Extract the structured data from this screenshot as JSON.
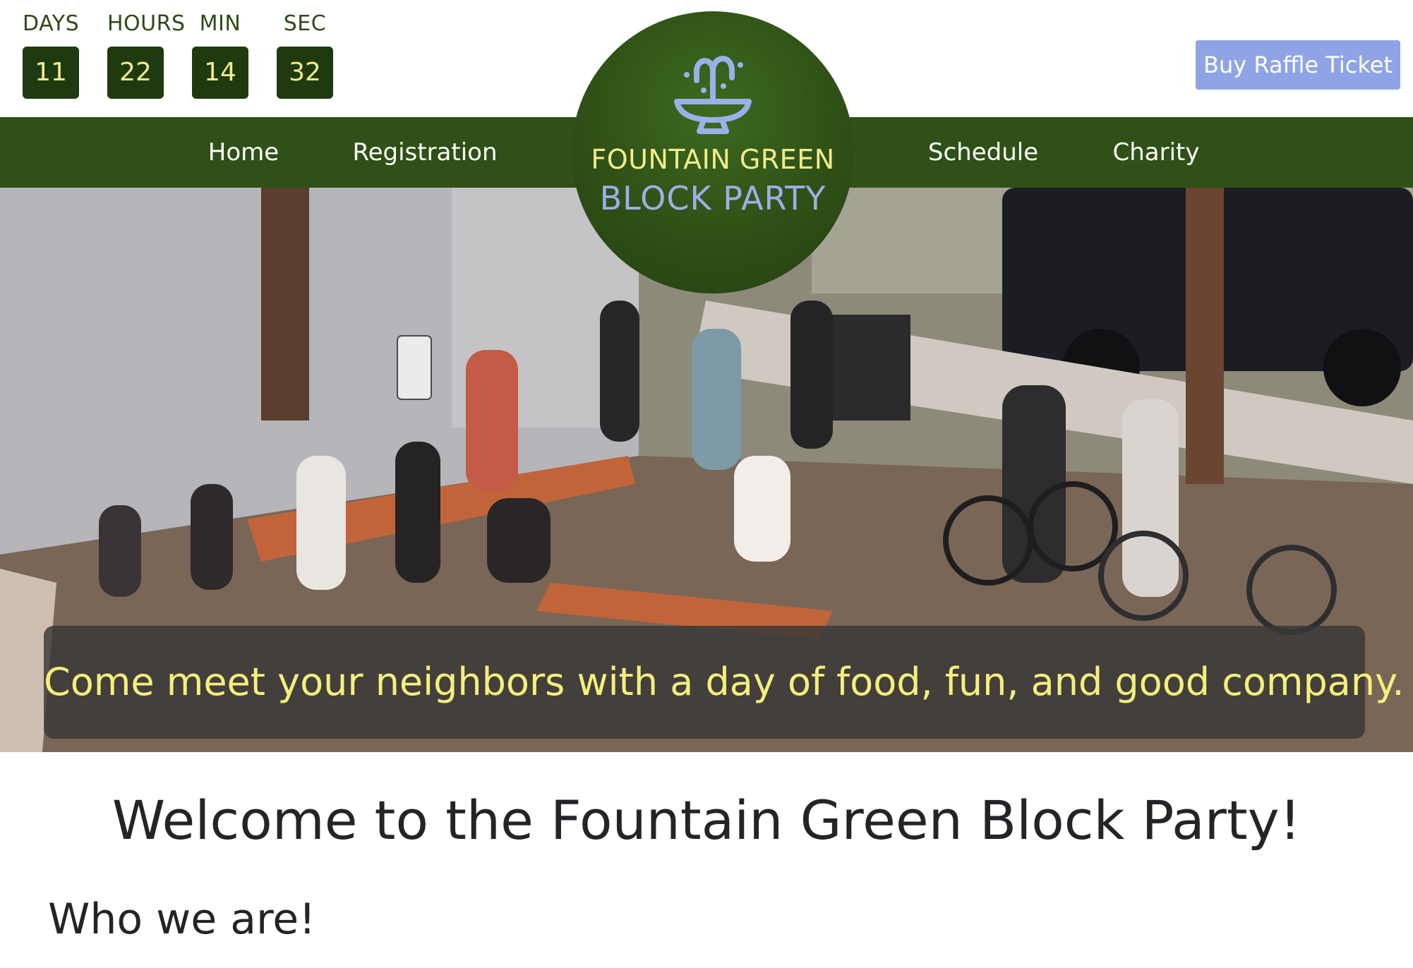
{
  "countdown": {
    "units": [
      {
        "label": "DAYS",
        "value": "11"
      },
      {
        "label": "HOURS",
        "value": "22"
      },
      {
        "label": "MIN",
        "value": "14"
      },
      {
        "label": "SEC",
        "value": "32"
      }
    ]
  },
  "header": {
    "raffle_button": "Buy Raffle Ticket"
  },
  "logo": {
    "line1": "FOUNTAIN GREEN",
    "line2": "BLOCK PARTY",
    "icon": "fountain-icon"
  },
  "nav": {
    "items": [
      {
        "label": "Home"
      },
      {
        "label": "Registration"
      },
      {
        "label": "Schedule"
      },
      {
        "label": "Charity"
      }
    ]
  },
  "hero": {
    "caption": "Come meet your neighbors with a day of food, fun, and good company."
  },
  "main": {
    "welcome_heading": "Welcome to the Fountain Green Block Party!",
    "who_heading": "Who we are!"
  },
  "colors": {
    "nav_green": "#2f5016",
    "countdown_box": "#1f3a0f",
    "accent_yellow": "#f3ec8a",
    "raffle_blue": "#8ea4e6",
    "logo_blue": "#9ab0e8"
  }
}
